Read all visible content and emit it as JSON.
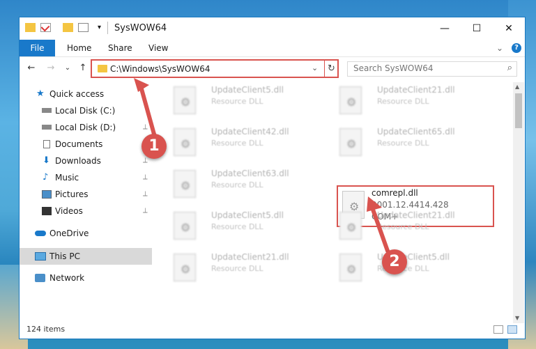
{
  "window": {
    "title": "SysWOW64",
    "minimize_glyph": "—",
    "maximize_glyph": "☐",
    "close_glyph": "✕"
  },
  "ribbon": {
    "tabs": [
      "File",
      "Home",
      "Share",
      "View"
    ],
    "expand_glyph": "⌄",
    "help_glyph": "?"
  },
  "address": {
    "path": "C:\\Windows\\SysWOW64",
    "dropdown_glyph": "⌄",
    "refresh_glyph": "↻",
    "search_placeholder": "Search SysWOW64",
    "search_glyph": "⌕"
  },
  "nav_buttons": {
    "back": "←",
    "forward": "→",
    "recent": "⌄",
    "up": "↑"
  },
  "sidebar": {
    "items": [
      {
        "label": "Quick access",
        "icon": "star-icon",
        "pinned": false
      },
      {
        "label": "Local Disk (C:)",
        "icon": "drive-icon",
        "pinned": true
      },
      {
        "label": "Local Disk (D:)",
        "icon": "drive-icon",
        "pinned": true
      },
      {
        "label": "Documents",
        "icon": "document-icon",
        "pinned": true
      },
      {
        "label": "Downloads",
        "icon": "download-icon",
        "pinned": true
      },
      {
        "label": "Music",
        "icon": "music-icon",
        "pinned": true
      },
      {
        "label": "Pictures",
        "icon": "picture-icon",
        "pinned": true
      },
      {
        "label": "Videos",
        "icon": "video-icon",
        "pinned": true
      },
      {
        "label": "OneDrive",
        "icon": "cloud-icon",
        "pinned": false
      },
      {
        "label": "This PC",
        "icon": "computer-icon",
        "pinned": false
      },
      {
        "label": "Network",
        "icon": "network-icon",
        "pinned": false
      }
    ],
    "pin_glyph": "📌"
  },
  "files": [
    {
      "name": "UpdateClient5.dll",
      "type": "Resource DLL"
    },
    {
      "name": "UpdateClient21.dll",
      "type": "Resource DLL"
    },
    {
      "name": "UpdateClient42.dll",
      "type": "Resource DLL"
    },
    {
      "name": "UpdateClient65.dll",
      "type": "Resource DLL"
    },
    {
      "name": "UpdateClient63.dll",
      "type": "Resource DLL"
    },
    {
      "name": "comrepl.dll",
      "version": "2001.12.4414.428",
      "type": "COM+"
    },
    {
      "name": "UpdateClient5.dll",
      "type": "Resource DLL"
    },
    {
      "name": "UpdateClient21.dll",
      "type": "Resource DLL"
    },
    {
      "name": "UpdateClient21.dll",
      "type": "Resource DLL"
    },
    {
      "name": "UpdateClient5.dll",
      "type": "Resource DLL"
    }
  ],
  "gear_glyph": "⚙",
  "status": {
    "items": "124 items"
  },
  "annotations": {
    "badge1": "1",
    "badge2": "2",
    "color": "#d9534f"
  }
}
